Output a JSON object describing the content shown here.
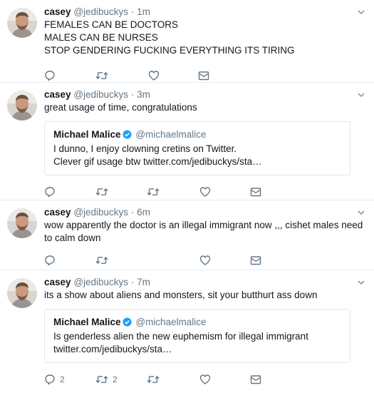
{
  "colors": {
    "icon": "#657786",
    "verified": "#1da1f2",
    "border": "#e6ecf0"
  },
  "tweets": [
    {
      "name": "casey",
      "handle": "@jedibuckys",
      "dot": "·",
      "time": "1m",
      "lines": [
        "FEMALES CAN BE DOCTORS",
        "MALES CAN BE NURSES",
        "STOP GENDERING FUCKING EVERYTHING ITS TIRING"
      ],
      "actions": [
        "reply-icon",
        "retweet-icon",
        "like-icon",
        "dm-icon"
      ]
    },
    {
      "name": "casey",
      "handle": "@jedibuckys",
      "dot": "·",
      "time": "3m",
      "lines": [
        "great usage of time, congratulations"
      ],
      "quote": {
        "name": "Michael Malice",
        "handle": "@michaelmalice",
        "lines": [
          "I dunno, I enjoy clowning cretins on Twitter.",
          "Clever gif usage btw twitter.com/jedibuckys/sta…"
        ]
      },
      "actions": [
        "reply-icon",
        "retweet-icon",
        "retweet-icon",
        "like-icon",
        "dm-icon"
      ]
    },
    {
      "name": "casey",
      "handle": "@jedibuckys",
      "dot": "·",
      "time": "6m",
      "lines": [
        "wow apparently the doctor is an illegal immigrant now ,,,  cishet males need",
        "to calm down"
      ],
      "actions": [
        "reply-icon",
        "retweet-icon",
        "like-icon",
        "dm-icon"
      ]
    },
    {
      "name": "casey",
      "handle": "@jedibuckys",
      "dot": "·",
      "time": "7m",
      "lines": [
        "its a show about aliens and monsters, sit your butthurt ass down"
      ],
      "quote": {
        "name": "Michael Malice",
        "handle": "@michaelmalice",
        "lines": [
          "Is genderless alien the new euphemism for illegal immigrant",
          "twitter.com/jedibuckys/sta…"
        ]
      },
      "reply_count": "2",
      "retweet_count": "2",
      "actions": [
        "reply-icon",
        "retweet-icon",
        "retweet-icon",
        "like-icon",
        "dm-icon"
      ]
    }
  ]
}
